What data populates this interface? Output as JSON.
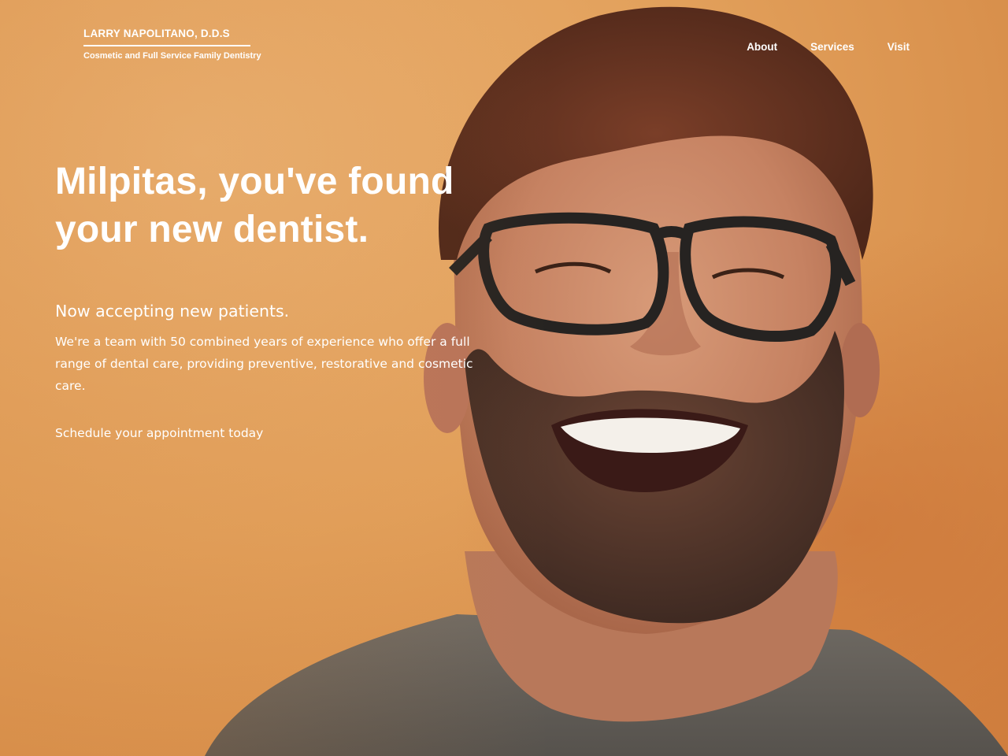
{
  "brand": {
    "name": "LARRY NAPOLITANO, D.D.S",
    "tagline": "Cosmetic and Full Service Family Dentistry"
  },
  "nav": {
    "items": [
      {
        "label": "About"
      },
      {
        "label": "Services"
      },
      {
        "label": "Visit"
      }
    ]
  },
  "hero": {
    "title_line1": "Milpitas, you've found",
    "title_line2": "your new dentist.",
    "subtitle": "Now accepting new patients.",
    "body": "We're a team with 50 combined years of experience who offer a full range of dental care, providing preventive, restorative and cosmetic care.",
    "cta": "Schedule your appointment today",
    "image": "smiling-man-with-glasses-photo"
  },
  "colors": {
    "background": "#e0a05c",
    "text": "#ffffff"
  }
}
